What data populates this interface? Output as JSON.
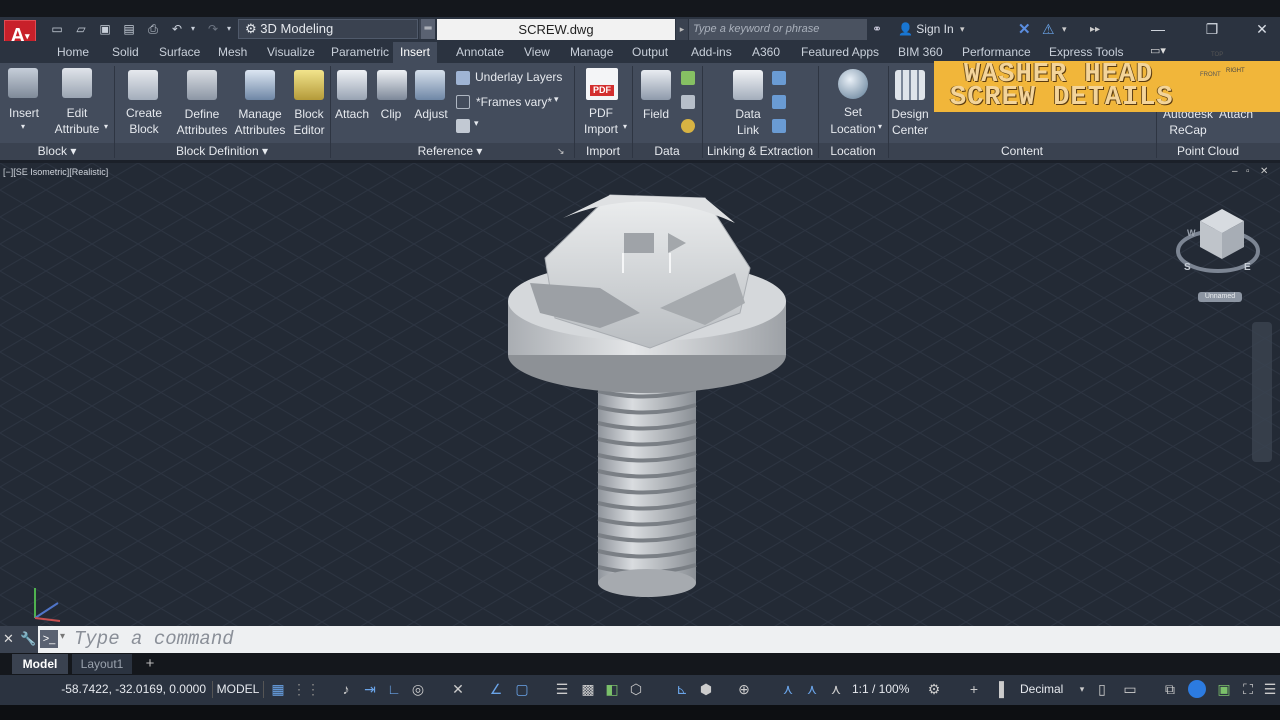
{
  "titlebar": {
    "app_button": "A",
    "workspace": "3D Modeling",
    "filename": "SCREW.dwg",
    "search_placeholder": "Type a keyword or phrase",
    "signin": "Sign In"
  },
  "tabs": [
    "Home",
    "Solid",
    "Surface",
    "Mesh",
    "Visualize",
    "Parametric",
    "Insert",
    "Annotate",
    "View",
    "Manage",
    "Output",
    "Add-ins",
    "A360",
    "Featured Apps",
    "BIM 360",
    "Performance",
    "Express Tools"
  ],
  "active_tab": "Insert",
  "ribbon": {
    "block": {
      "insert": "Insert",
      "edit1": "Edit",
      "edit2": "Attribute",
      "title": "Block"
    },
    "block_def": {
      "create1": "Create",
      "create2": "Block",
      "define1": "Define",
      "define2": "Attributes",
      "manage1": "Manage",
      "manage2": "Attributes",
      "editor1": "Block",
      "editor2": "Editor",
      "title": "Block Definition"
    },
    "reference": {
      "attach": "Attach",
      "clip": "Clip",
      "adjust": "Adjust",
      "underlay": "Underlay Layers",
      "frames": "*Frames vary*",
      "title": "Reference"
    },
    "import": {
      "pdf1": "PDF",
      "pdf2": "Import",
      "title": "Import",
      "pdf_badge": "PDF"
    },
    "data": {
      "field": "Field",
      "title": "Data"
    },
    "linking": {
      "datalink1": "Data",
      "datalink2": "Link",
      "title": "Linking & Extraction"
    },
    "location": {
      "set1": "Set",
      "set2": "Location",
      "title": "Location"
    },
    "content": {
      "design1": "Design",
      "design2": "Center",
      "title": "Content"
    },
    "pointcloud": {
      "autodesk": "Autodesk",
      "attach": "Attach",
      "recap": "ReCap",
      "title": "Point Cloud"
    }
  },
  "overlay_title": {
    "line1": "WASHER HEAD",
    "line2": "SCREW DETAILS"
  },
  "viewport": {
    "label": "[−][SE Isometric][Realistic]",
    "viewcube_top": "TOP",
    "viewcube_front": "FRONT",
    "viewcube_right": "RIGHT",
    "unnamed": "Unnamed",
    "compass_s": "S",
    "compass_e": "E",
    "compass_w": "W"
  },
  "command": {
    "placeholder": "Type a command"
  },
  "layout_tabs": {
    "model": "Model",
    "layout1": "Layout1",
    "add": "+"
  },
  "status": {
    "coords": "-58.7422, -32.0169, 0.0000",
    "model": "MODEL",
    "scale": "1:1 / 100%",
    "units": "Decimal"
  }
}
